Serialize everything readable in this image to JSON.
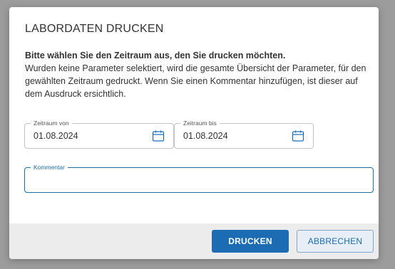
{
  "dialog": {
    "title": "LABORDATEN DRUCKEN",
    "intro_bold": "Bitte wählen Sie den Zeitraum aus, den Sie drucken möchten.",
    "intro_text": "Wurden keine Parameter selektiert, wird die gesamte Übersicht der Parameter, für den gewählten Zeitraum gedruckt. Wenn Sie einen Kommentar hinzufügen, ist dieser auf dem Ausdruck ersichtlich."
  },
  "fields": {
    "from": {
      "label": "Zeitraum von",
      "value": "01.08.2024",
      "icon": "calendar-icon"
    },
    "to": {
      "label": "Zeitraum bis",
      "value": "01.08.2024",
      "icon": "calendar-icon"
    },
    "comment": {
      "label": "Kommentar",
      "value": ""
    }
  },
  "buttons": {
    "print": "DRUCKEN",
    "cancel": "ABBRECHEN"
  },
  "colors": {
    "accent": "#1b6cb3",
    "overlay": "#9c9c9c",
    "footer": "#ececec"
  }
}
